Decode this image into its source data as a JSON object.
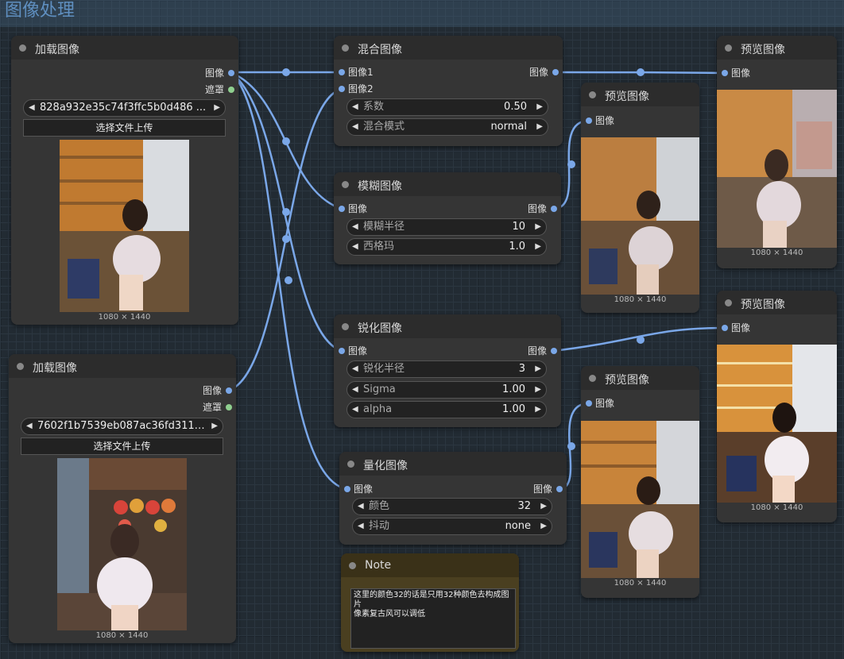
{
  "group": {
    "title": "图像处理"
  },
  "load1": {
    "title": "加载图像",
    "out_image": "图像",
    "out_mask": "遮罩",
    "filename": "828a932e35c74f3ffc5b0d486 ...",
    "upload": "选择文件上传",
    "dims": "1080 × 1440"
  },
  "load2": {
    "title": "加载图像",
    "out_image": "图像",
    "out_mask": "遮罩",
    "filename": "7602f1b7539eb087ac36fd311b ...",
    "upload": "选择文件上传",
    "dims": "1080 × 1440"
  },
  "blend": {
    "title": "混合图像",
    "in1": "图像1",
    "in2": "图像2",
    "out": "图像",
    "factor_label": "系数",
    "factor_value": "0.50",
    "mode_label": "混合模式",
    "mode_value": "normal"
  },
  "blur": {
    "title": "模糊图像",
    "in": "图像",
    "out": "图像",
    "radius_label": "模糊半径",
    "radius_value": "10",
    "sigma_label": "西格玛",
    "sigma_value": "1.0"
  },
  "sharpen": {
    "title": "锐化图像",
    "in": "图像",
    "out": "图像",
    "radius_label": "锐化半径",
    "radius_value": "3",
    "sigma_label": "Sigma",
    "sigma_value": "1.00",
    "alpha_label": "alpha",
    "alpha_value": "1.00"
  },
  "quantize": {
    "title": "量化图像",
    "in": "图像",
    "out": "图像",
    "colors_label": "颜色",
    "colors_value": "32",
    "dither_label": "抖动",
    "dither_value": "none"
  },
  "note": {
    "title": "Note",
    "text": "这里的颜色32的话是只用32种颜色去构成图片\n像素复古风可以调低"
  },
  "preview1": {
    "title": "预览图像",
    "in": "图像",
    "dims": "1080 × 1440"
  },
  "preview2": {
    "title": "预览图像",
    "in": "图像",
    "dims": "1080 × 1440"
  },
  "preview3": {
    "title": "预览图像",
    "in": "图像",
    "dims": "1080 × 1440"
  },
  "preview4": {
    "title": "预览图像",
    "in": "图像",
    "dims": "1080 × 1440"
  },
  "colors": {
    "image_port": "#7aa7e8",
    "mask_port": "#8fcf8f",
    "wire": "#7aa7e8",
    "node_bg": "#353535",
    "header_bg": "#2c2c2c",
    "note_bg": "#4a3f20"
  },
  "icons": {
    "arrow_left": "◀",
    "arrow_right": "▶"
  }
}
